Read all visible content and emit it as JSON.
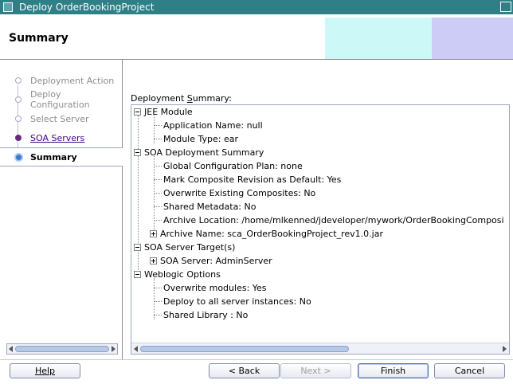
{
  "window": {
    "title": "Deploy OrderBookingProject"
  },
  "header": {
    "title": "Summary"
  },
  "steps": [
    {
      "label": "Deployment Action",
      "state": "done"
    },
    {
      "label": "Deploy Configuration",
      "state": "done"
    },
    {
      "label": "Select Server",
      "state": "done"
    },
    {
      "label": "SOA Servers",
      "state": "link"
    },
    {
      "label": "Summary",
      "state": "current"
    }
  ],
  "main": {
    "summary_label_prefix": "Deployment ",
    "summary_label_mnemonic": "S",
    "summary_label_suffix": "ummary:"
  },
  "tree": {
    "jee_module": "JEE Module",
    "app_name": "Application Name: null",
    "module_type": "Module Type: ear",
    "soa_summary": "SOA Deployment Summary",
    "global_config": "Global Configuration Plan: none",
    "mark_revision": "Mark Composite Revision as Default: Yes",
    "overwrite_composites": "Overwrite Existing Composites: No",
    "shared_metadata": "Shared Metadata: No",
    "archive_location": "Archive Location: /home/mlkenned/jdeveloper/mywork/OrderBookingComposi",
    "archive_name": "Archive Name: sca_OrderBookingProject_rev1.0.jar",
    "soa_targets": "SOA Server Target(s)",
    "soa_server": "SOA Server: AdminServer",
    "weblogic": "Weblogic Options",
    "overwrite_modules": "Overwrite modules: Yes",
    "deploy_all": "Deploy to all server instances: No",
    "shared_library": "Shared Library : No"
  },
  "buttons": {
    "help": "Help",
    "back": "< Back",
    "next": "Next >",
    "finish": "Finish",
    "cancel": "Cancel"
  }
}
